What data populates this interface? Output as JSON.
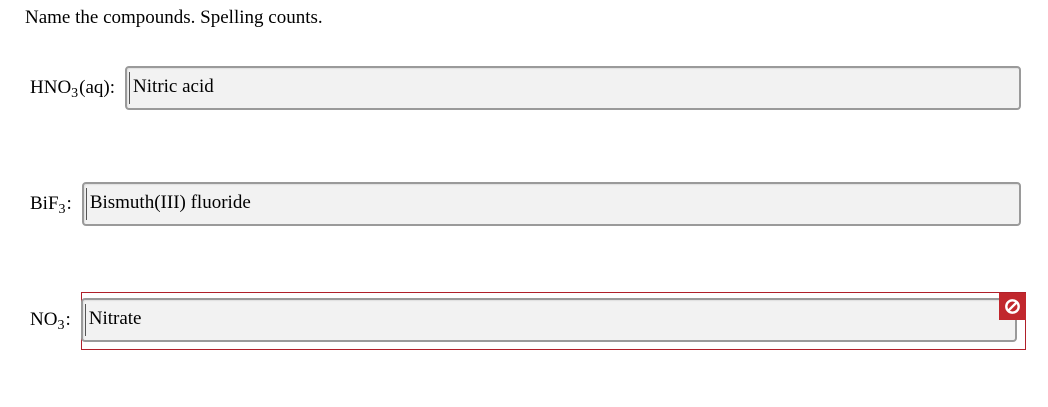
{
  "instructions": "Name the compounds. Spelling counts.",
  "questions": [
    {
      "formula_main": "HNO",
      "formula_sub": "3",
      "formula_tail": "(aq):",
      "answer": "Nitric acid",
      "status": "neutral"
    },
    {
      "formula_main": "BiF",
      "formula_sub": "3",
      "formula_tail": ":",
      "answer": "Bismuth(III) fluoride",
      "status": "neutral"
    },
    {
      "formula_main": "NO",
      "formula_sub": "3",
      "formula_tail": ":",
      "answer": "Nitrate",
      "status": "incorrect"
    }
  ],
  "colors": {
    "incorrect": "#c1272d",
    "input_bg": "#f2f2f2",
    "input_border": "#9a9a9a"
  },
  "icons": {
    "incorrect": "prohibited-icon"
  }
}
